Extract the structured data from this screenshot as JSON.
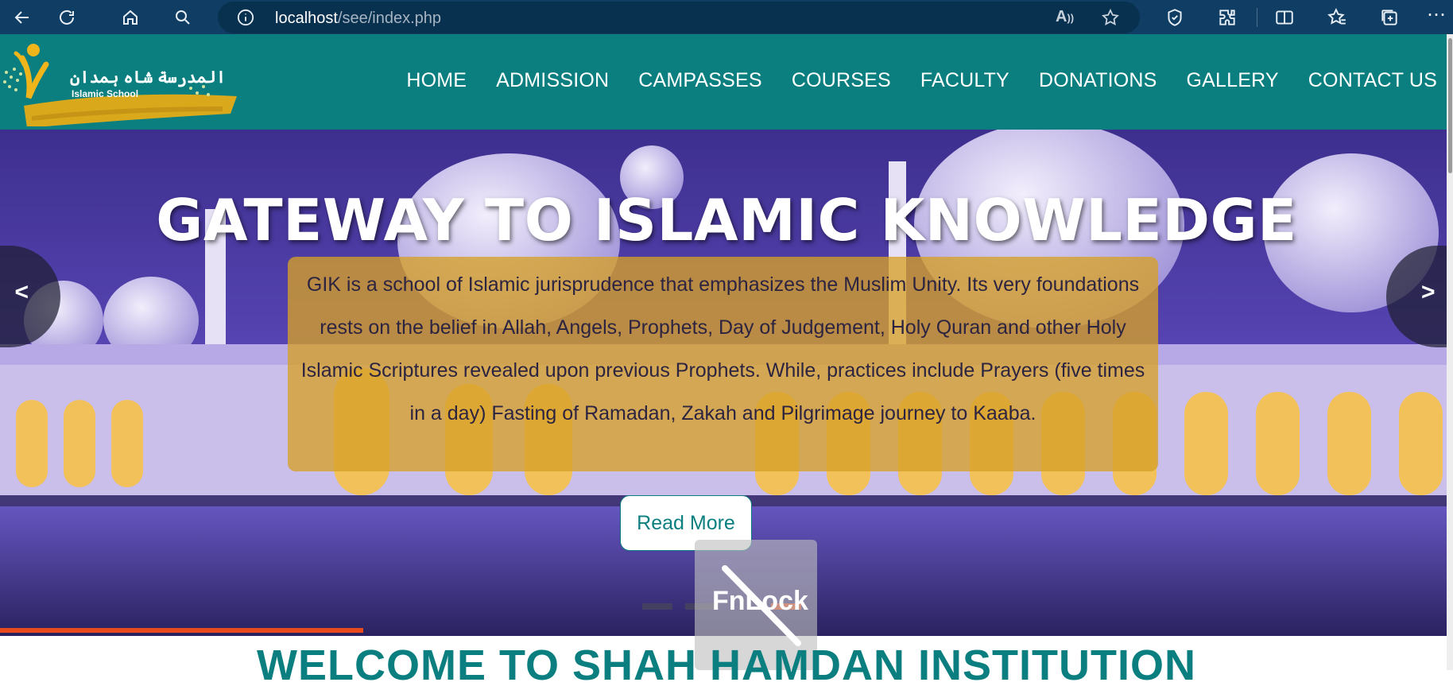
{
  "browser": {
    "url_host": "localhost",
    "url_path": "/see/index.php",
    "read_aloud_label": "A))",
    "icons": [
      "back-icon",
      "refresh-icon",
      "home-icon",
      "search-icon",
      "info-icon",
      "read-aloud-icon",
      "favorite-star-icon",
      "shield-icon",
      "extensions-icon",
      "split-screen-icon",
      "favorites-icon",
      "collections-icon",
      "more-icon"
    ]
  },
  "header": {
    "logo_arabic": "المدرسة شاہ ہمدان",
    "logo_subtitle": "Islamic School",
    "nav": [
      "HOME",
      "ADMISSION",
      "CAMPASSES",
      "COURSES",
      "FACULTY",
      "DONATIONS",
      "GALLERY",
      "CONTACT US"
    ]
  },
  "hero": {
    "title": "GATEWAY TO ISLAMIC KNOWLEDGE",
    "text": "GIK is a school of Islamic jurisprudence that emphasizes the Muslim Unity. Its very foundations rests on the belief in Allah, Angels, Prophets, Day of Judgement, Holy Quran and other Holy Islamic Scriptures revealed upon previous Prophets. While, practices include Prayers (five times in a day) Fasting of Ramadan, Zakah and Pilgrimage journey to Kaaba.",
    "button": "Read More",
    "prev": "<",
    "next": ">",
    "slide_progress": 0.25
  },
  "overlay": {
    "label": "FnLock"
  },
  "welcome": {
    "heading": "WELCOME TO SHAH HAMDAN INSTITUTION"
  },
  "colors": {
    "browser_bar": "#0f3d63",
    "header": "#0b7f80",
    "accent": "#e84a1c",
    "text_box": "#d6a028"
  }
}
